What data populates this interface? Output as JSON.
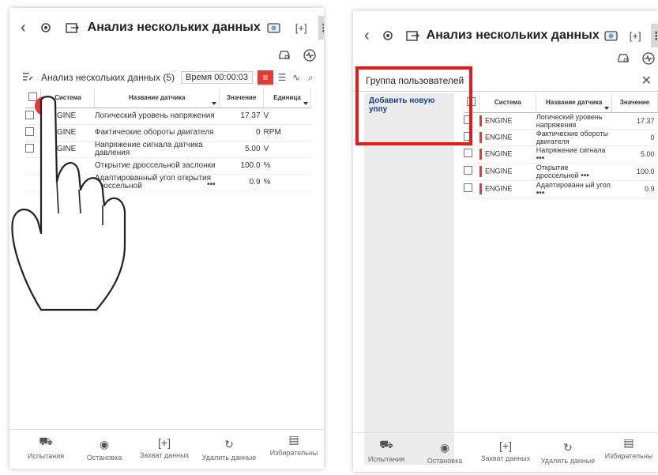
{
  "app": {
    "title": "Анализ нескольких данных",
    "param_count_label": "Анализ нескольких данных (5)",
    "time_label": "Время 00:00:03"
  },
  "table": {
    "columns": [
      "Система",
      "Название датчика",
      "Значение",
      "Единица"
    ],
    "rows": [
      {
        "system": "ENGINE",
        "sensor": "Логический уровень напряжения",
        "value": "17.37",
        "unit": "V"
      },
      {
        "system": "ENGINE",
        "sensor": "Фактические обороты двигателя",
        "value": "0",
        "unit": "RPM"
      },
      {
        "system": "ENGINE",
        "sensor": "Напряжение сигнала датчика давления",
        "value": "5.00",
        "unit": "V"
      },
      {
        "system": "ENGINE",
        "sensor": "Открытие дроссельной заслонки",
        "value": "100.0",
        "unit": "%"
      },
      {
        "system": "ENGINE",
        "sensor": "Адаптированный угол открытия дроссельной",
        "value": "0.9",
        "unit": "%"
      }
    ]
  },
  "left": {
    "rows_system": [
      "ENGINE",
      "ENGINE",
      "ENGINE",
      "",
      ""
    ],
    "rows_sensor": [
      "Логический уровень напряжения",
      "Фактические обороты двигателя",
      "Напряжение сигнала датчика давления",
      "Открытие дроссельной заслонки",
      "Адаптированный угол открытия дроссельной"
    ],
    "more": "•••"
  },
  "right": {
    "group_title": "Группа пользователей",
    "add_group": "Добавить новую уппу",
    "rows_sensor": [
      "Логический уровень напряжения",
      "Фактические обороты двигателя",
      "Напряжение сигнала",
      "Открытие дроссельной",
      "Адаптированн ый угол"
    ],
    "more": "•••"
  },
  "bottom_nav": [
    "Испытания",
    "Остановка",
    "Захват данных",
    "Удалить данные",
    "Избирательны"
  ],
  "icons": {
    "back": "chevron-left-icon",
    "gear": "gear-icon",
    "export": "export-icon",
    "camera": "camera-icon",
    "expand": "fullscreen-icon",
    "more": "more-vertical-icon",
    "car": "car-icon",
    "pulse": "pulse-icon",
    "edit": "edit-list-icon",
    "search": "search-icon",
    "close": "close-icon"
  },
  "colors": {
    "accent_red": "#e53935",
    "frame_red": "#e21b1b",
    "link_blue": "#1a3f8a"
  }
}
